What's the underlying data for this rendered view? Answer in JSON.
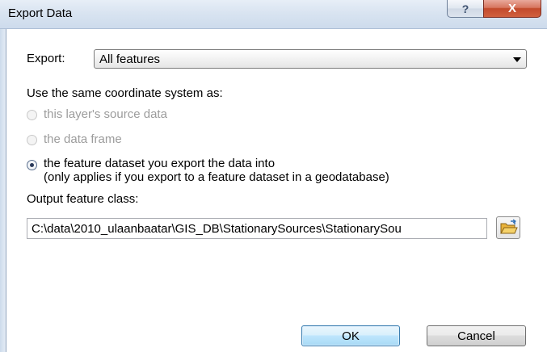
{
  "window": {
    "title": "Export Data",
    "help_label": "?",
    "close_label": "X"
  },
  "export": {
    "label": "Export:",
    "selected": "All features"
  },
  "coordinate_system": {
    "label": "Use the same coordinate system as:",
    "options": [
      {
        "label": "this layer's source data",
        "enabled": false,
        "checked": false
      },
      {
        "label": "the data frame",
        "enabled": false,
        "checked": false
      },
      {
        "label": "the feature dataset you export the data into",
        "sublabel": "(only applies if you export to a feature dataset in a geodatabase)",
        "enabled": true,
        "checked": true
      }
    ]
  },
  "output": {
    "label": "Output feature class:",
    "value": "C:\\data\\2010_ulaanbaatar\\GIS_DB\\StationarySources\\StationarySou",
    "browse_icon": "folder-open-icon"
  },
  "buttons": {
    "ok": "OK",
    "cancel": "Cancel"
  },
  "colors": {
    "ok_border": "#3c7fb1",
    "close_button": "#c24a2c",
    "disabled_text": "#9c9c9c"
  }
}
